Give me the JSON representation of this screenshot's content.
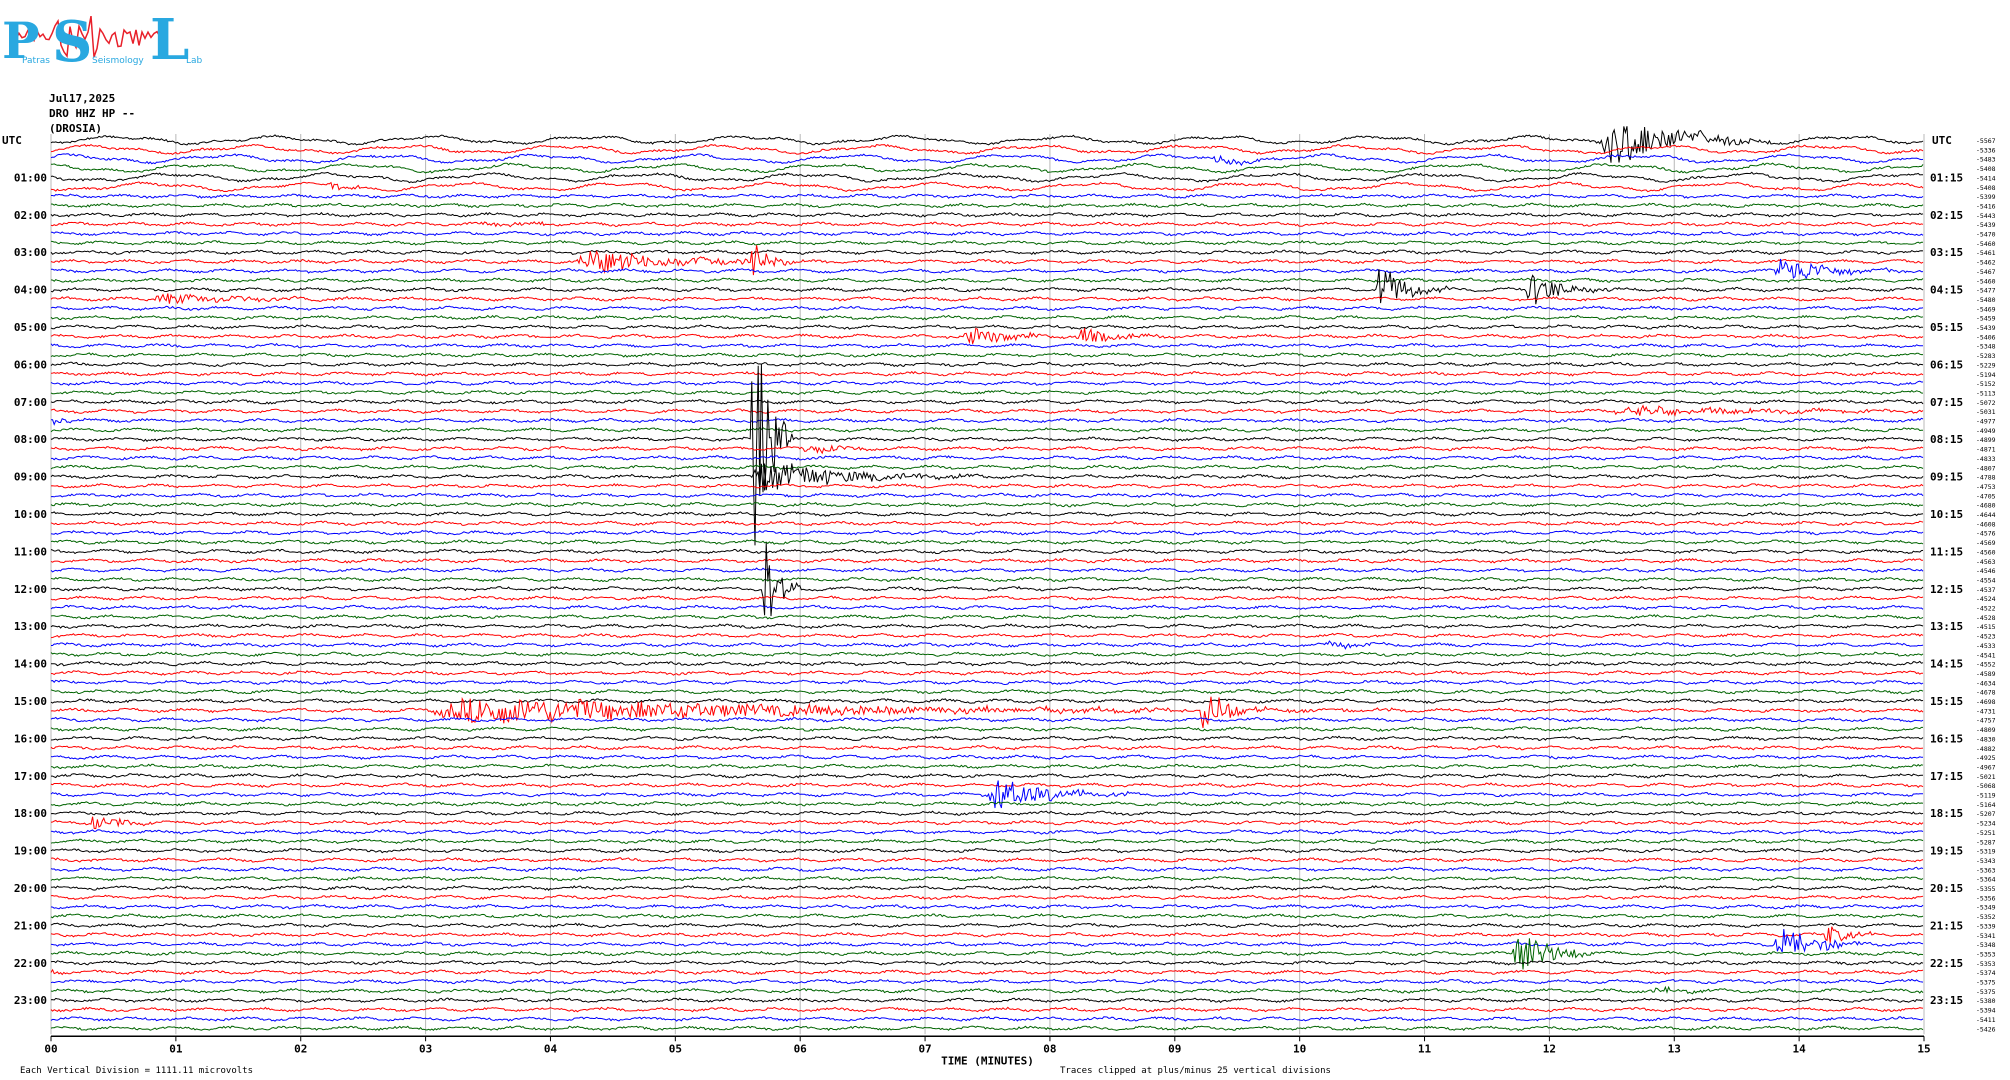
{
  "logo": {
    "letters": [
      "P",
      "S",
      "L"
    ],
    "words": [
      "Patras",
      "Seismology",
      "Lab"
    ],
    "color": "#29a8e0",
    "accent": "#e8202a"
  },
  "header": {
    "date": "Jul17,2025",
    "station": "DRO HHZ HP --",
    "site": "(DROSIA)"
  },
  "axis": {
    "left_title": "UTC",
    "right_title": "UTC",
    "left_labels": [
      "01:00",
      "02:00",
      "03:00",
      "04:00",
      "05:00",
      "06:00",
      "07:00",
      "08:00",
      "09:00",
      "10:00",
      "11:00",
      "12:00",
      "13:00",
      "14:00",
      "15:00",
      "16:00",
      "17:00",
      "18:00",
      "19:00",
      "20:00",
      "21:00",
      "22:00",
      "23:00"
    ],
    "right_labels": [
      "01:15",
      "02:15",
      "03:15",
      "04:15",
      "05:15",
      "06:15",
      "07:15",
      "08:15",
      "09:15",
      "10:15",
      "11:15",
      "12:15",
      "13:15",
      "14:15",
      "15:15",
      "16:15",
      "17:15",
      "18:15",
      "19:15",
      "20:15",
      "21:15",
      "22:15",
      "23:15"
    ],
    "x_ticks": [
      "00",
      "01",
      "02",
      "03",
      "04",
      "05",
      "06",
      "07",
      "08",
      "09",
      "10",
      "11",
      "12",
      "13",
      "14",
      "15"
    ],
    "xlabel": "TIME (MINUTES)"
  },
  "footer": {
    "left": "Each Vertical Division = 1111.11 microvolts",
    "center": "Traces clipped at plus/minus 25 vertical divisions"
  },
  "chart_data": {
    "type": "line",
    "title": "",
    "xlabel": "TIME (MINUTES)",
    "ylabel": "UTC",
    "xlim": [
      0,
      15
    ],
    "trace_minutes": 15,
    "trace_count": 96,
    "colors": [
      "#000000",
      "#ff0000",
      "#0000ff",
      "#006400"
    ],
    "grid": true,
    "trace_offsets": [
      "-5567",
      "-5336",
      "-5483",
      "-5408",
      "-5414",
      "-5408",
      "-5399",
      "-5416",
      "-5443",
      "-5439",
      "-5470",
      "-5460",
      "-5461",
      "-5462",
      "-5467",
      "-5460",
      "-5477",
      "-5480",
      "-5469",
      "-5459",
      "-5439",
      "-5406",
      "-5348",
      "-5283",
      "-5229",
      "-5194",
      "-5152",
      "-5113",
      "-5072",
      "-5031",
      "-4977",
      "-4949",
      "-4899",
      "-4871",
      "-4833",
      "-4807",
      "-4788",
      "-4753",
      "-4705",
      "-4680",
      "-4644",
      "-4608",
      "-4576",
      "-4569",
      "-4560",
      "-4563",
      "-4546",
      "-4554",
      "-4537",
      "-4524",
      "-4522",
      "-4528",
      "-4515",
      "-4523",
      "-4533",
      "-4541",
      "-4552",
      "-4589",
      "-4634",
      "-4678",
      "-4698",
      "-4731",
      "-4757",
      "-4809",
      "-4830",
      "-4882",
      "-4925",
      "-4967",
      "-5021",
      "-5068",
      "-5119",
      "-5164",
      "-5207",
      "-5234",
      "-5251",
      "-5287",
      "-5319",
      "-5343",
      "-5363",
      "-5364",
      "-5355",
      "-5356",
      "-5349",
      "-5352",
      "-5339",
      "-5341",
      "-5348",
      "-5353",
      "-5353",
      "-5374",
      "-5375",
      "-5375",
      "-5380",
      "-5394",
      "-5411",
      "-5426"
    ],
    "events": [
      {
        "row": 0,
        "t0": 12.4,
        "t1": 13.8,
        "amp": 30
      },
      {
        "row": 2,
        "t0": 9.3,
        "t1": 10.2,
        "amp": 4
      },
      {
        "row": 5,
        "t0": 2.2,
        "t1": 2.8,
        "amp": 4
      },
      {
        "row": 9,
        "t0": 3.4,
        "t1": 4.9,
        "amp": 3
      },
      {
        "row": 13,
        "t0": 4.2,
        "t1": 6.3,
        "amp": 14
      },
      {
        "row": 13,
        "t0": 5.6,
        "t1": 6.0,
        "amp": 20
      },
      {
        "row": 14,
        "t0": 13.8,
        "t1": 14.8,
        "amp": 18
      },
      {
        "row": 16,
        "t0": 10.6,
        "t1": 11.2,
        "amp": 30
      },
      {
        "row": 16,
        "t0": 11.8,
        "t1": 12.5,
        "amp": 22
      },
      {
        "row": 17,
        "t0": 0.8,
        "t1": 2.5,
        "amp": 7
      },
      {
        "row": 21,
        "t0": 7.3,
        "t1": 8.2,
        "amp": 12
      },
      {
        "row": 21,
        "t0": 8.2,
        "t1": 9.0,
        "amp": 10
      },
      {
        "row": 29,
        "t0": 12.5,
        "t1": 15.0,
        "amp": 7
      },
      {
        "row": 30,
        "t0": 0.0,
        "t1": 0.4,
        "amp": 5
      },
      {
        "row": 33,
        "t0": 6.0,
        "t1": 6.8,
        "amp": 6
      },
      {
        "row": 32,
        "t0": 5.6,
        "t1": 5.95,
        "amp": 180
      },
      {
        "row": 36,
        "t0": 5.6,
        "t1": 7.5,
        "amp": 20
      },
      {
        "row": 48,
        "t0": 5.7,
        "t1": 6.0,
        "amp": 70
      },
      {
        "row": 54,
        "t0": 10.2,
        "t1": 10.9,
        "amp": 4
      },
      {
        "row": 57,
        "t0": 0.1,
        "t1": 0.3,
        "amp": 3
      },
      {
        "row": 61,
        "t0": 3.0,
        "t1": 10.8,
        "amp": 16
      },
      {
        "row": 61,
        "t0": 9.2,
        "t1": 9.8,
        "amp": 26
      },
      {
        "row": 70,
        "t0": 7.5,
        "t1": 8.7,
        "amp": 20
      },
      {
        "row": 73,
        "t0": 0.3,
        "t1": 0.9,
        "amp": 12
      },
      {
        "row": 87,
        "t0": 11.7,
        "t1": 12.4,
        "amp": 34
      },
      {
        "row": 86,
        "t0": 13.8,
        "t1": 14.6,
        "amp": 22
      },
      {
        "row": 85,
        "t0": 14.2,
        "t1": 14.7,
        "amp": 12
      },
      {
        "row": 89,
        "t0": 0.0,
        "t1": 0.2,
        "amp": 3
      },
      {
        "row": 91,
        "t0": 12.8,
        "t1": 13.6,
        "amp": 6
      }
    ]
  }
}
